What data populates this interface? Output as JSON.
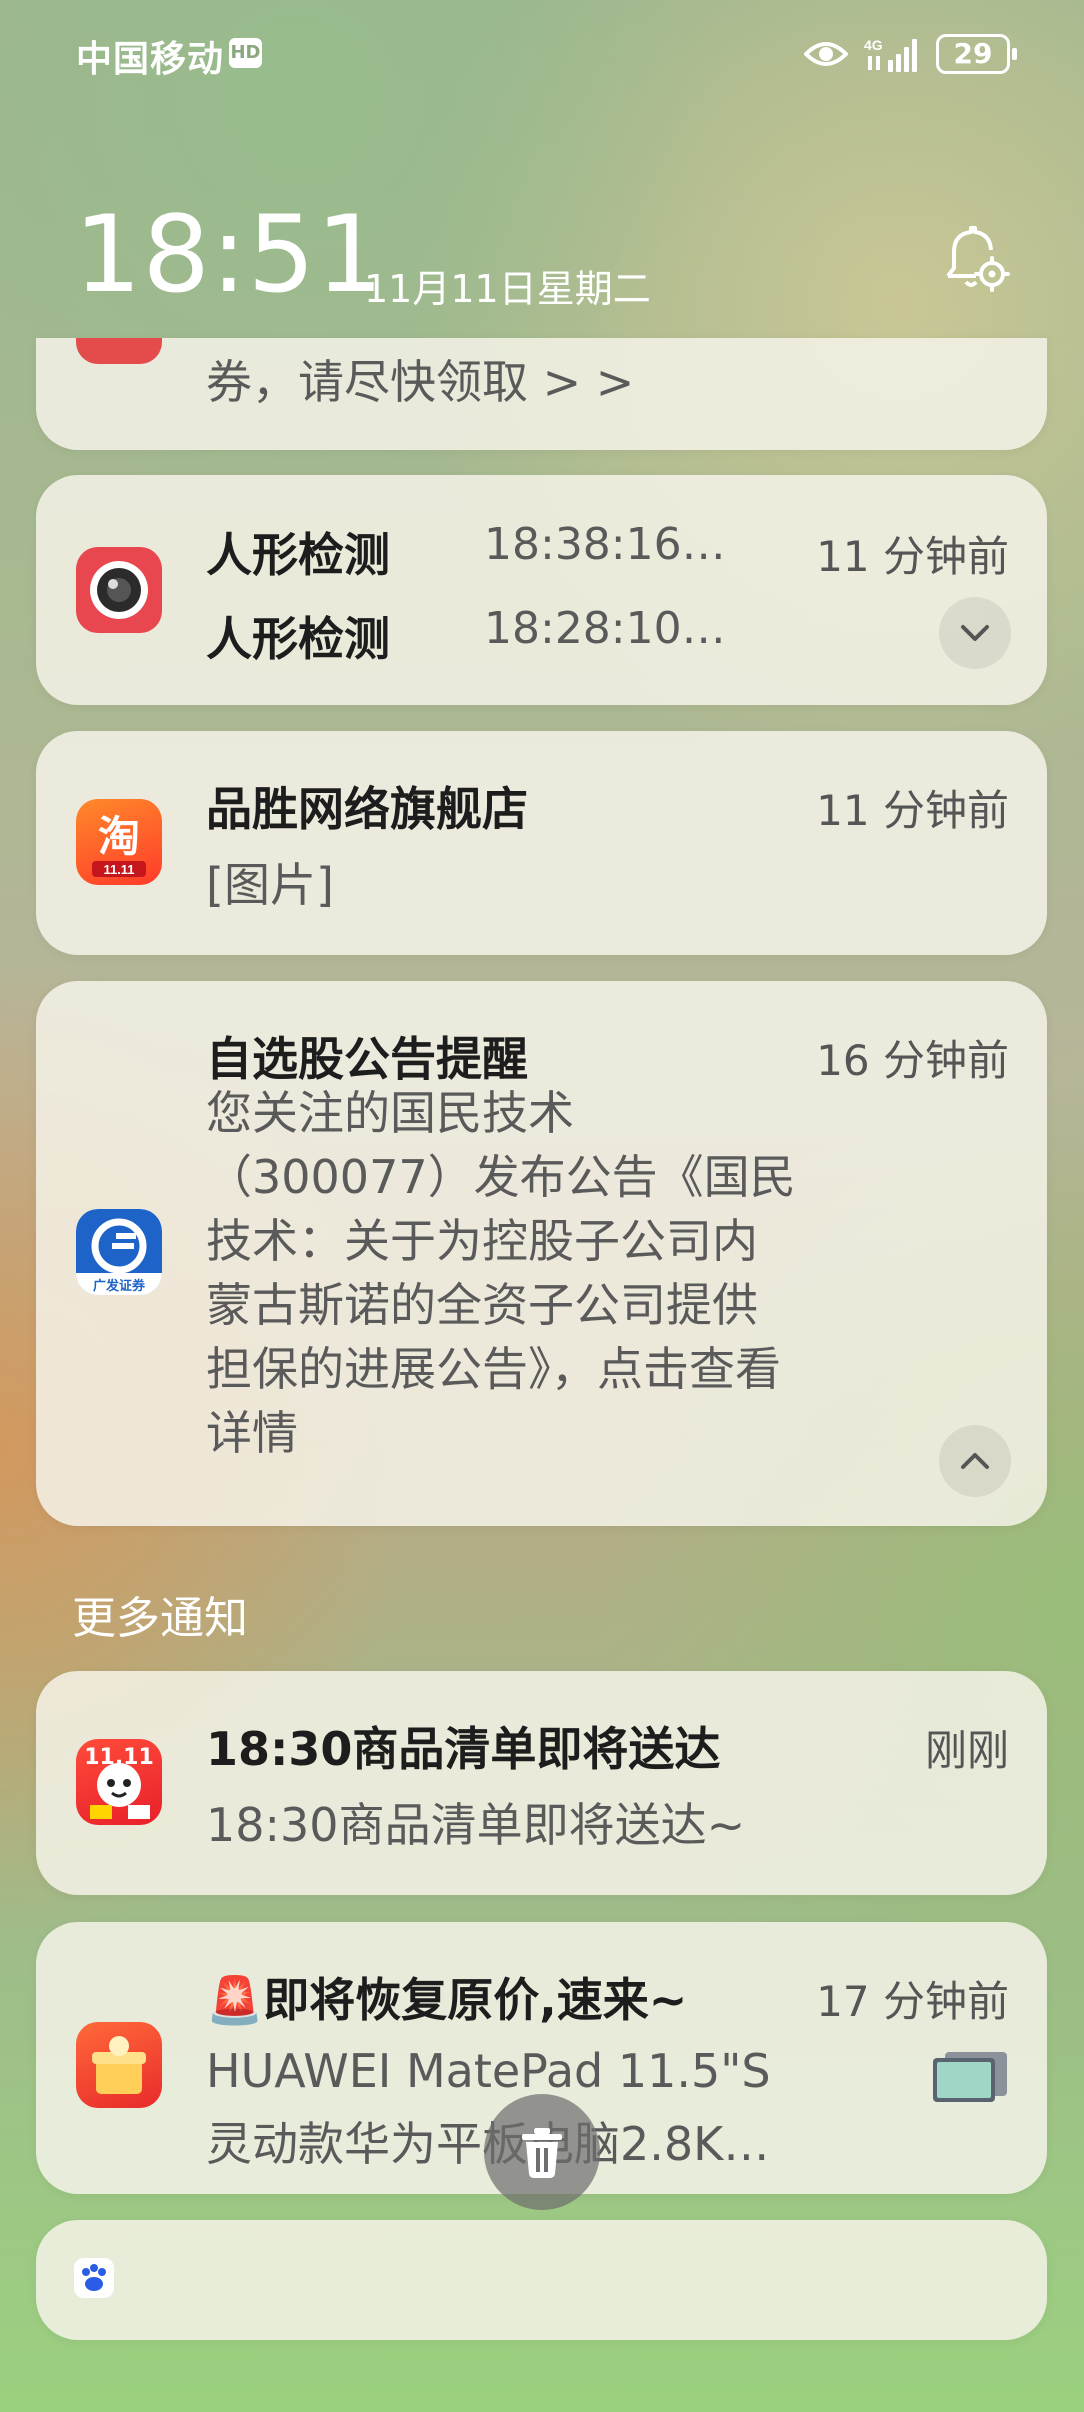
{
  "status_bar": {
    "carrier": "中国移动",
    "hd_badge": "HD",
    "network": "4G",
    "battery": "29",
    "icons": [
      "eye-icon",
      "signal-icon",
      "battery-icon"
    ]
  },
  "lockscreen": {
    "time": "18:51",
    "date": "11月11日星期二"
  },
  "notifications": [
    {
      "app_icon": "coupon-app-icon",
      "line1": "券，请尽快领取 > >"
    },
    {
      "app_icon": "camera-icon",
      "title1": "人形检测",
      "sub1": "18:38:16…",
      "title2": "人形检测",
      "sub2": "18:28:10…",
      "time": "11 分钟前"
    },
    {
      "app_icon": "taobao-icon",
      "title": "品胜网络旗舰店",
      "body": "[图片]",
      "time": "11 分钟前"
    },
    {
      "app_icon": "gf-securities-icon",
      "icon_label": "广发证券",
      "title": "自选股公告提醒",
      "time": "16 分钟前",
      "body_lines": [
        "您关注的国民技术",
        "（300077）发布公告《国民",
        "技术：关于为控股子公司内",
        "蒙古斯诺的全资子公司提供",
        "担保的进展公告》，点击查看",
        "详情"
      ]
    }
  ],
  "more_section": {
    "label": "更多通知",
    "items": [
      {
        "app_icon": "jd-1111-icon",
        "icon_label": "11.11",
        "title": "18:30商品清单即将送达",
        "body": "18:30商品清单即将送达~",
        "time": "刚刚"
      },
      {
        "app_icon": "red-gift-icon",
        "title": "🚨即将恢复原价,速来~",
        "body_line1": "HUAWEI MatePad 11.5\"S",
        "body_line2": "灵动款华为平板电脑2.8K…",
        "time": "17 分钟前"
      },
      {
        "app_icon": "baidu-icon"
      }
    ]
  },
  "colors": {
    "accent_red": "#e8474f",
    "gf_blue": "#1e63c8",
    "taobao_orange": "#ff5a1f"
  }
}
